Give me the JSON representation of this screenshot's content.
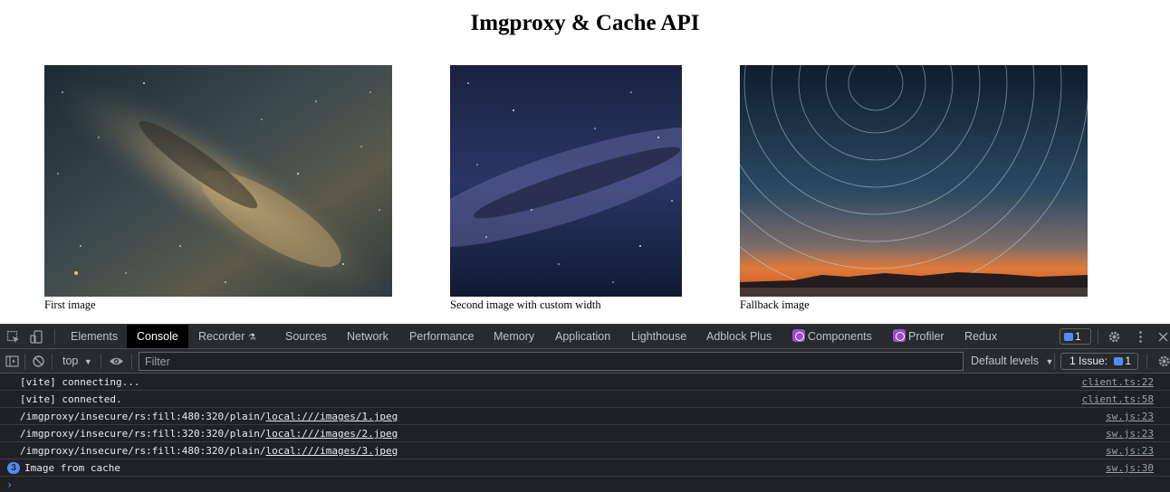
{
  "page": {
    "title": "Imgproxy & Cache API",
    "figures": [
      {
        "caption": "First image"
      },
      {
        "caption": "Second image with custom width"
      },
      {
        "caption": "Fallback image"
      }
    ]
  },
  "devtools": {
    "tabs": [
      "Elements",
      "Console",
      "Recorder",
      "Sources",
      "Network",
      "Performance",
      "Memory",
      "Application",
      "Lighthouse",
      "Adblock Plus",
      "Components",
      "Profiler",
      "Redux"
    ],
    "active_tab": "Console",
    "messages_badge": "1",
    "toolbar": {
      "context": "top",
      "filter_placeholder": "Filter",
      "levels": "Default levels",
      "issues_label": "1 Issue:",
      "issues_count": "1"
    },
    "console_rows": [
      {
        "text": "[vite] connecting...",
        "source": "client.ts:22"
      },
      {
        "text": "[vite] connected.",
        "source": "client.ts:58"
      },
      {
        "prefix": "/imgproxy/insecure/rs:fill:480:320/plain/",
        "link": "local:///images/1.jpeg",
        "source": "sw.js:23"
      },
      {
        "prefix": "/imgproxy/insecure/rs:fill:320:320/plain/",
        "link": "local:///images/2.jpeg",
        "source": "sw.js:23"
      },
      {
        "prefix": "/imgproxy/insecure/rs:fill:480:320/plain/",
        "link": "local:///images/3.jpeg",
        "source": "sw.js:23"
      },
      {
        "count": "3",
        "text": "Image from cache",
        "source": "sw.js:30"
      }
    ],
    "prompt": "›"
  },
  "colors": {
    "devtools_bg": "#202124",
    "accent": "#4f8ef7",
    "react_icon": "#9c4dcc"
  },
  "icons": [
    "inspect-icon",
    "device-toggle-icon",
    "flask-icon",
    "settings-gear-icon",
    "kebab-menu-icon",
    "close-icon",
    "sidebar-toggle-icon",
    "clear-console-icon",
    "eye-icon",
    "settings-icon"
  ]
}
